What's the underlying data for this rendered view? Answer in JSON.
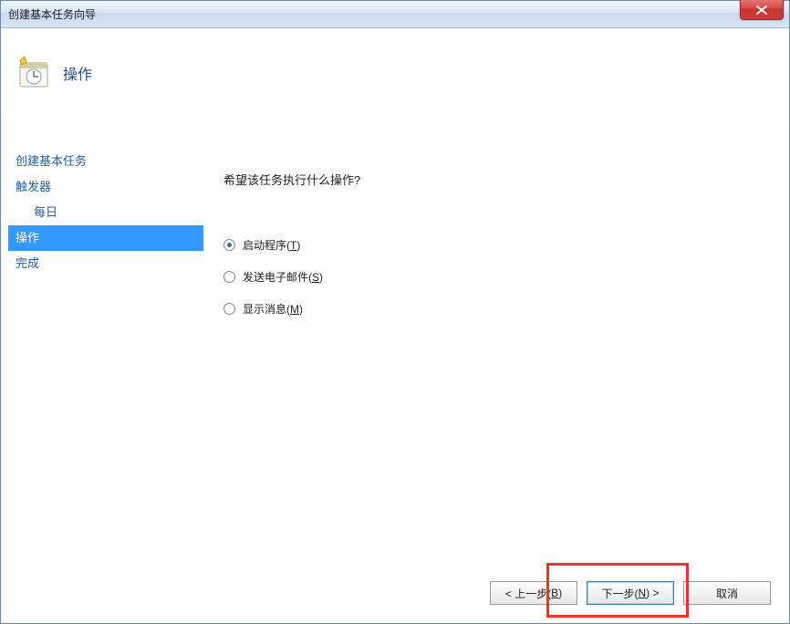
{
  "window": {
    "title": "创建基本任务向导"
  },
  "header": {
    "page_title": "操作"
  },
  "sidebar": {
    "items": [
      {
        "label": "创建基本任务",
        "selected": false,
        "sub": false
      },
      {
        "label": "触发器",
        "selected": false,
        "sub": false
      },
      {
        "label": "每日",
        "selected": false,
        "sub": true
      },
      {
        "label": "操作",
        "selected": true,
        "sub": false
      },
      {
        "label": "完成",
        "selected": false,
        "sub": false
      }
    ]
  },
  "content": {
    "question": "希望该任务执行什么操作?",
    "options": [
      {
        "label_pre": "启动程序(",
        "shortcut": "T",
        "label_post": ")",
        "checked": true
      },
      {
        "label_pre": "发送电子邮件(",
        "shortcut": "S",
        "label_post": ")",
        "checked": false
      },
      {
        "label_pre": "显示消息(",
        "shortcut": "M",
        "label_post": ")",
        "checked": false
      }
    ]
  },
  "buttons": {
    "back_pre": "< 上一步(",
    "back_shortcut": "B",
    "back_post": ")",
    "next_pre": "下一步(",
    "next_shortcut": "N",
    "next_post": ") >",
    "cancel": "取消"
  }
}
